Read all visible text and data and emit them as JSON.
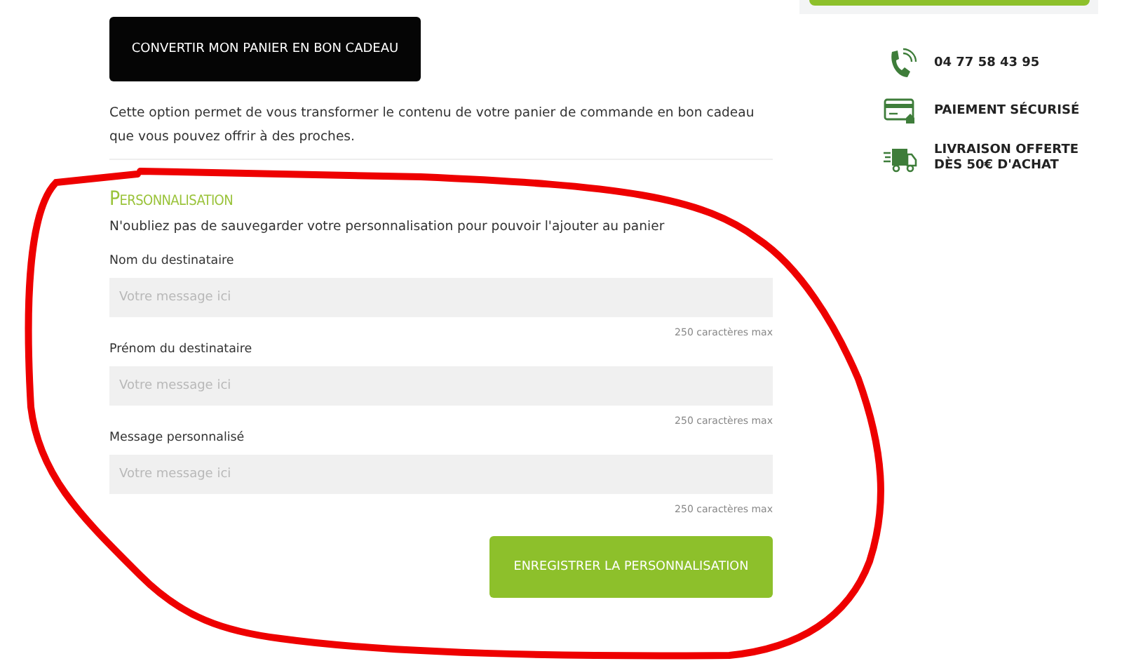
{
  "convert_button": {
    "label": "CONVERTIR MON PANIER EN BON CADEAU"
  },
  "description": "Cette option permet de vous transformer le contenu de votre panier de commande en bon cadeau que vous pouvez offrir à des proches.",
  "personalisation": {
    "title": "Personnalisation",
    "intro": "N'oubliez pas de sauvegarder votre personnalisation pour pouvoir l'ajouter au panier",
    "fields": [
      {
        "label": "Nom du destinataire",
        "placeholder": "Votre message ici",
        "hint": "250 caractères max"
      },
      {
        "label": "Prénom du destinataire",
        "placeholder": "Votre message ici",
        "hint": "250 caractères max"
      },
      {
        "label": "Message personnalisé",
        "placeholder": "Votre message ici",
        "hint": "250 caractères max"
      }
    ],
    "save_button": {
      "label": "ENREGISTRER LA PERSONNALISATION"
    }
  },
  "sidebar": {
    "features": [
      {
        "kind": "phone",
        "text": "04 77 58 43 95"
      },
      {
        "kind": "card",
        "text": "PAIEMENT SÉCURISÉ"
      },
      {
        "kind": "truck",
        "text": "LIVRAISON OFFERTE\nDÈS 50€ D'ACHAT"
      }
    ]
  }
}
